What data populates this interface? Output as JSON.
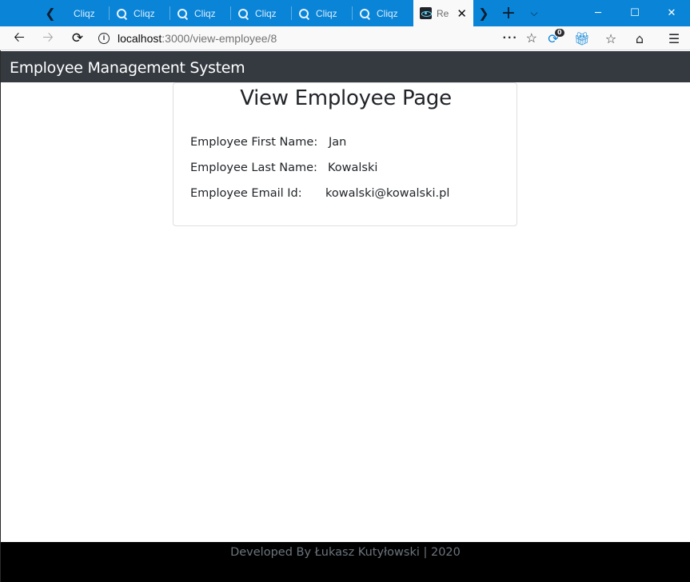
{
  "browser": {
    "tabs": [
      {
        "label": "Cliqz",
        "icon": "cliqz-icon",
        "active": false
      },
      {
        "label": "Cliqz",
        "icon": "cliqz-icon",
        "active": false
      },
      {
        "label": "Cliqz",
        "icon": "cliqz-icon",
        "active": false
      },
      {
        "label": "Cliqz",
        "icon": "cliqz-icon",
        "active": false
      },
      {
        "label": "Cliqz",
        "icon": "cliqz-icon",
        "active": false
      },
      {
        "label": "Cliqz",
        "icon": "cliqz-icon",
        "active": false
      },
      {
        "label": "Re",
        "icon": "react-icon",
        "active": true
      }
    ],
    "url_host": "localhost",
    "url_path": ":3000/view-employee/8",
    "extension_badge": "0",
    "colors": {
      "tabstrip": "#0a84d6",
      "toolbar": "#f9f9fa"
    }
  },
  "app": {
    "brand": "Employee Management System",
    "colors": {
      "navbar": "#343a40",
      "footer": "#000000"
    }
  },
  "card": {
    "title": "View Employee Page",
    "fields": [
      {
        "label": "Employee First Name:",
        "value": "Jan"
      },
      {
        "label": "Employee Last Name:",
        "value": "Kowalski"
      },
      {
        "label": "Employee Email Id:",
        "value": "kowalski@kowalski.pl"
      }
    ]
  },
  "footer": {
    "text": "Developed By Łukasz Kutyłowski | 2020"
  }
}
